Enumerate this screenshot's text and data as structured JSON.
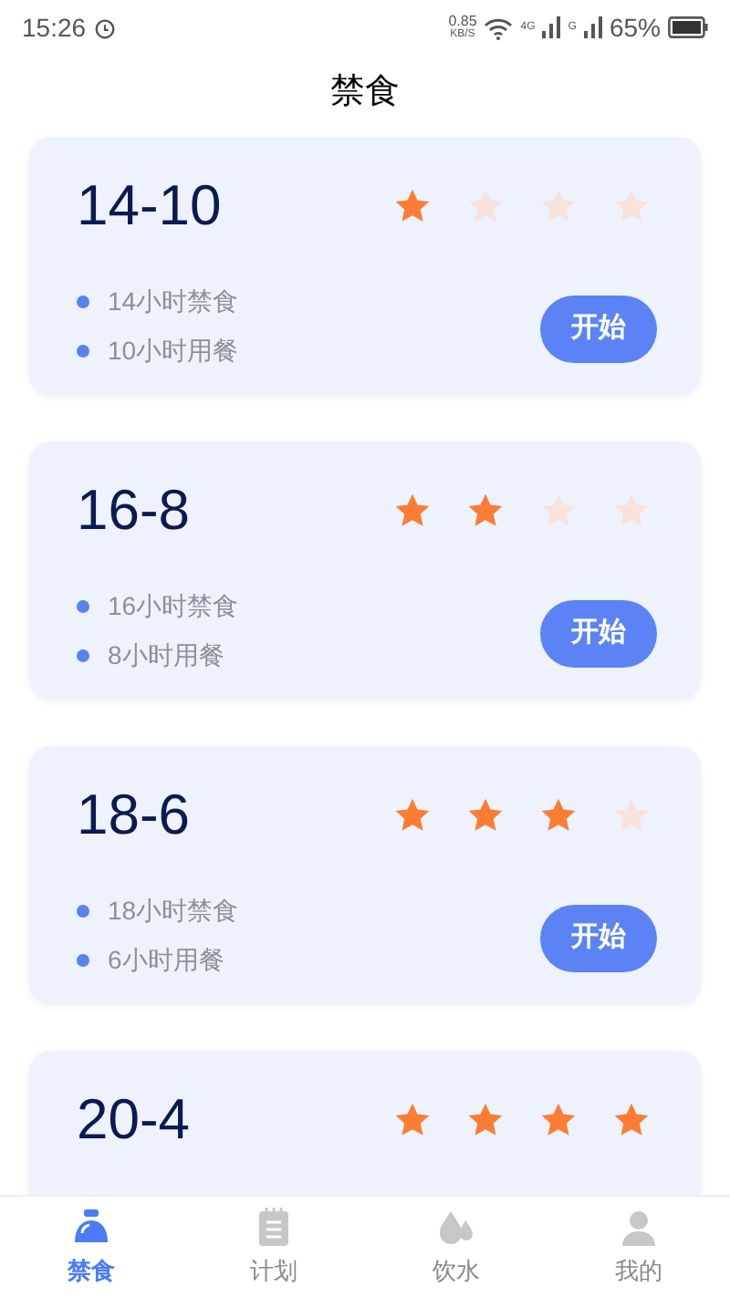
{
  "status_bar": {
    "time": "15:26",
    "speed_value": "0.85",
    "speed_unit": "KB/S",
    "sim1": "4G",
    "sim2": "G",
    "battery": "65%"
  },
  "title": "禁食",
  "plans": [
    {
      "name": "14-10",
      "stars": 1,
      "lines": [
        "14小时禁食",
        "10小时用餐"
      ],
      "button": "开始"
    },
    {
      "name": "16-8",
      "stars": 2,
      "lines": [
        "16小时禁食",
        "8小时用餐"
      ],
      "button": "开始"
    },
    {
      "name": "18-6",
      "stars": 3,
      "lines": [
        "18小时禁食",
        "6小时用餐"
      ],
      "button": "开始"
    },
    {
      "name": "20-4",
      "stars": 4
    }
  ],
  "tabs": [
    {
      "label": "禁食",
      "kind": "fasting",
      "selected": true
    },
    {
      "label": "计划",
      "kind": "plan",
      "selected": false
    },
    {
      "label": "饮水",
      "kind": "water",
      "selected": false
    },
    {
      "label": "我的",
      "kind": "profile",
      "selected": false
    }
  ]
}
